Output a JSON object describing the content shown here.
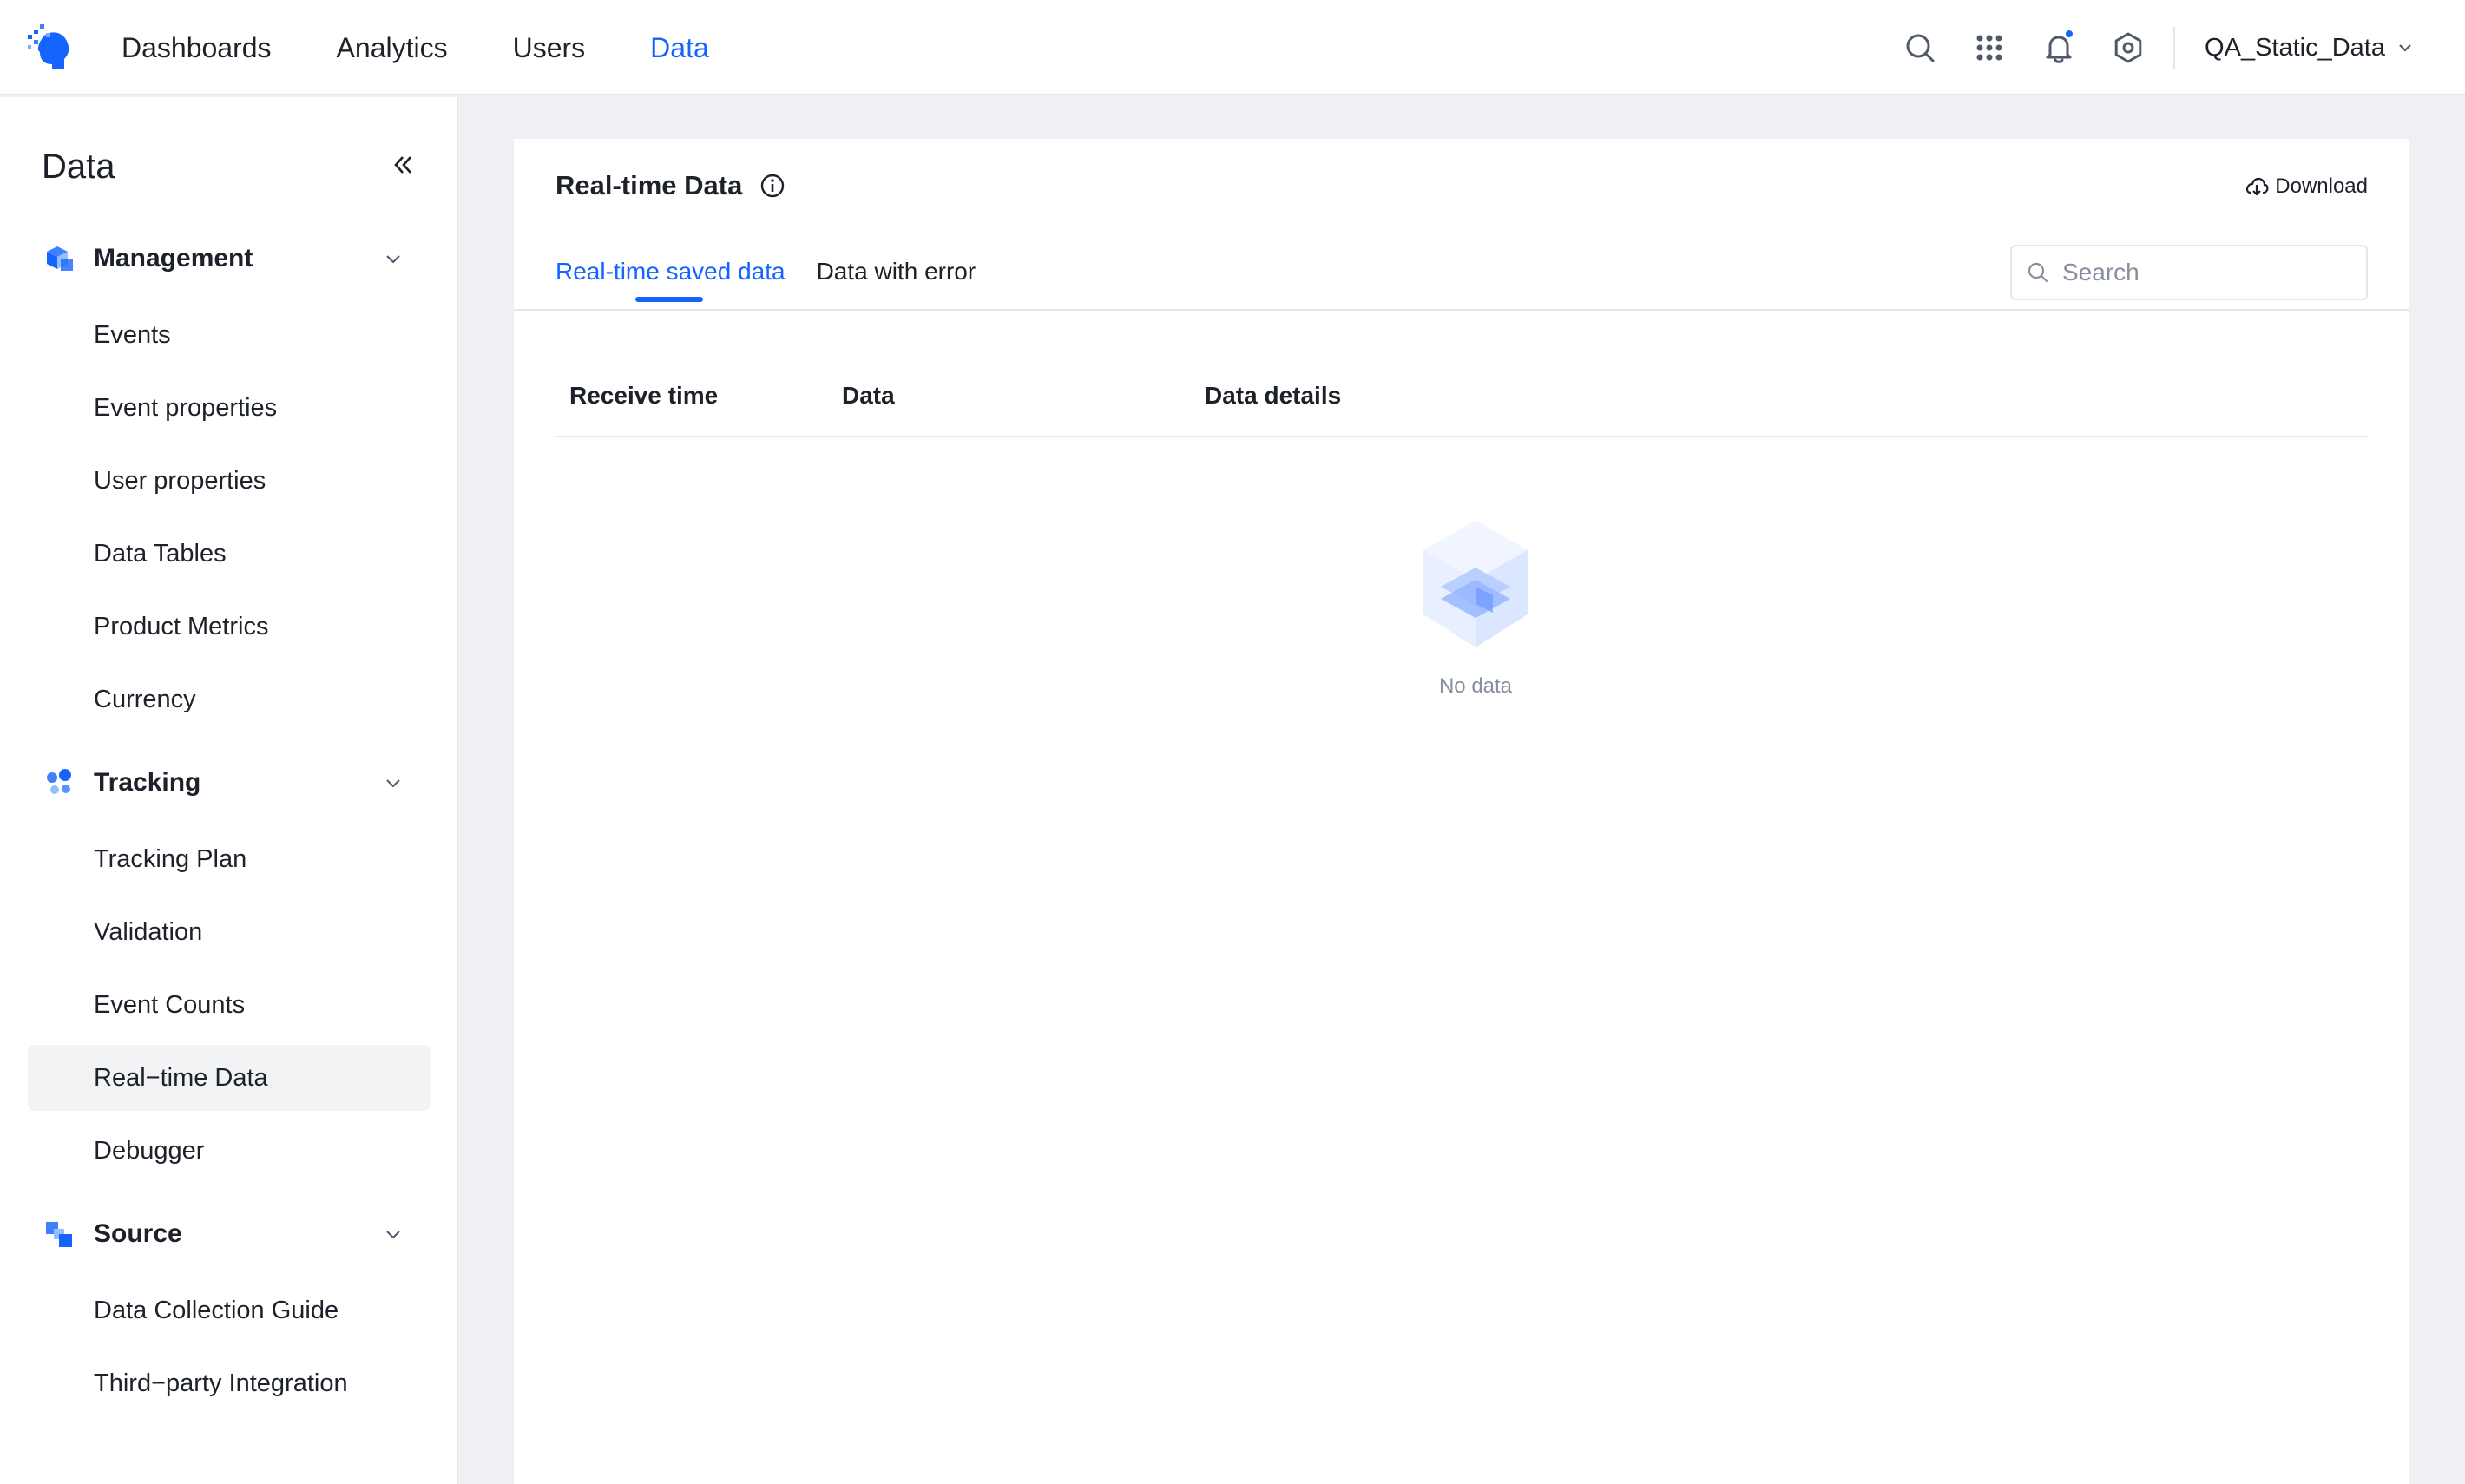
{
  "nav": {
    "items": [
      {
        "label": "Dashboards",
        "active": false
      },
      {
        "label": "Analytics",
        "active": false
      },
      {
        "label": "Users",
        "active": false
      },
      {
        "label": "Data",
        "active": true
      }
    ],
    "workspace": "QA_Static_Data",
    "icons": [
      "search-icon",
      "apps-grid-icon",
      "bell-icon",
      "gear-icon"
    ],
    "accent": "#1664ff"
  },
  "sidebar": {
    "title": "Data",
    "groups": [
      {
        "label": "Management",
        "icon": "cube-icon",
        "items": [
          "Events",
          "Event properties",
          "User properties",
          "Data Tables",
          "Product Metrics",
          "Currency"
        ]
      },
      {
        "label": "Tracking",
        "icon": "tracking-dots-icon",
        "items": [
          "Tracking Plan",
          "Validation",
          "Event Counts",
          "Real−time Data",
          "Debugger"
        ]
      },
      {
        "label": "Source",
        "icon": "source-squares-icon",
        "items": [
          "Data Collection Guide",
          "Third−party Integration"
        ]
      }
    ],
    "active_item": "Real−time Data"
  },
  "main": {
    "title": "Real-time Data",
    "download_label": "Download",
    "tabs": [
      {
        "label": "Real-time saved data",
        "active": true
      },
      {
        "label": "Data with error",
        "active": false
      }
    ],
    "search_placeholder": "Search",
    "columns": [
      "Receive time",
      "Data",
      "Data details"
    ],
    "empty_text": "No data"
  }
}
